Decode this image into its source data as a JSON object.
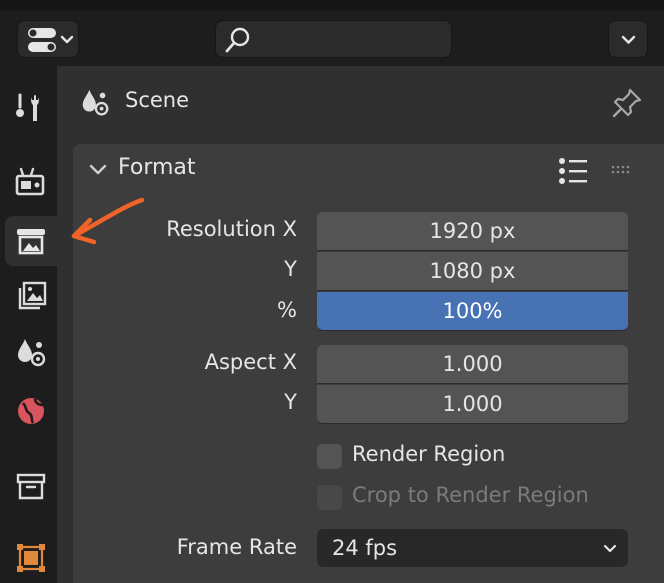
{
  "header": {
    "search": {
      "value": "",
      "placeholder": ""
    }
  },
  "sidebar": {
    "tabs": [
      {
        "name": "tool",
        "icon": "tool-icon"
      },
      {
        "name": "render",
        "icon": "render-icon"
      },
      {
        "name": "output",
        "icon": "output-icon",
        "active": true
      },
      {
        "name": "view-layer",
        "icon": "view-layer-icon"
      },
      {
        "name": "scene",
        "icon": "scene-icon"
      },
      {
        "name": "world",
        "icon": "world-icon"
      },
      {
        "name": "collection",
        "icon": "collection-icon"
      },
      {
        "name": "object",
        "icon": "object-icon"
      }
    ]
  },
  "panel": {
    "context_title": "Scene",
    "format": {
      "title": "Format",
      "resolution_x_label": "Resolution X",
      "resolution_x_value": "1920 px",
      "resolution_y_label": "Y",
      "resolution_y_value": "1080 px",
      "percent_label": "%",
      "percent_value": "100%",
      "aspect_x_label": "Aspect X",
      "aspect_x_value": "1.000",
      "aspect_y_label": "Y",
      "aspect_y_value": "1.000",
      "render_region_label": "Render Region",
      "crop_label": "Crop to Render Region",
      "frame_rate_label": "Frame Rate",
      "frame_rate_value": "24 fps"
    }
  },
  "colors": {
    "accent_blue": "#4772b3",
    "arrow_annotation": "#f0642a",
    "world_icon": "#d9545e",
    "object_icon": "#e0883c"
  }
}
